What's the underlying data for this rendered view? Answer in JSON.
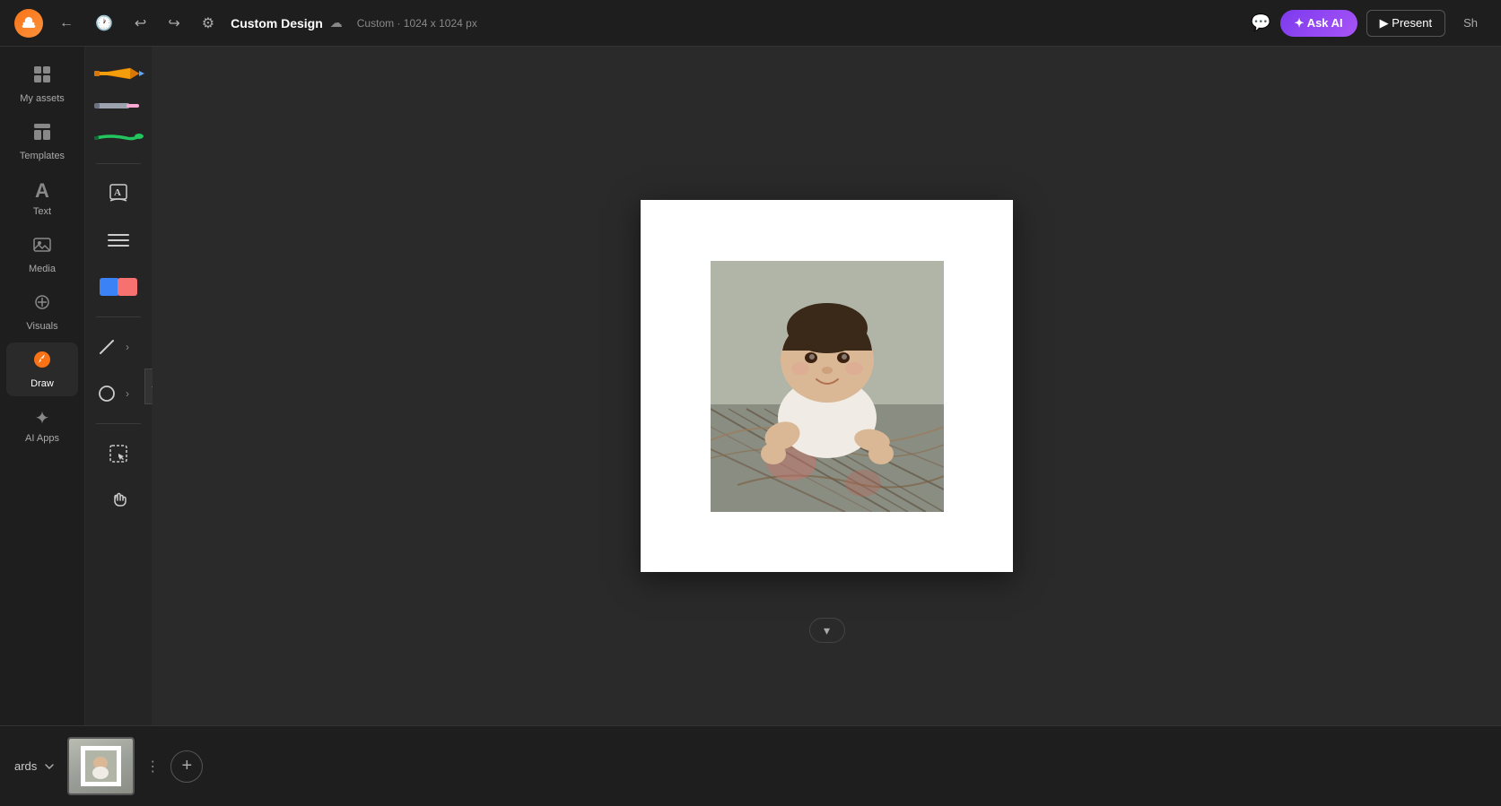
{
  "header": {
    "logo_symbol": "🔥",
    "title": "Custom Design",
    "subtitle": "Custom · 1024 x 1024 px",
    "cloud_icon": "☁",
    "ask_ai_label": "✦ Ask AI",
    "present_label": "▶ Present",
    "share_label": "Sh",
    "comment_icon": "💬"
  },
  "sidebar": {
    "items": [
      {
        "id": "my-assets",
        "label": "My assets",
        "icon": "🗂"
      },
      {
        "id": "templates",
        "label": "Templates",
        "icon": "⊞"
      },
      {
        "id": "text",
        "label": "Text",
        "icon": "A"
      },
      {
        "id": "media",
        "label": "Media",
        "icon": "🖼"
      },
      {
        "id": "visuals",
        "label": "Visuals",
        "icon": "⬇"
      },
      {
        "id": "draw",
        "label": "Draw",
        "icon": "✏",
        "active": true
      },
      {
        "id": "ai-apps",
        "label": "AI Apps",
        "icon": "✦"
      }
    ]
  },
  "tools": {
    "pencil_color": "#f59e0b",
    "marker_color": "#9ca3af",
    "brush_color": "#22c55e",
    "swatch_colors": [
      "#3b82f6",
      "#f87171"
    ],
    "text_tool_icon": "⊞",
    "align_icon": "☰",
    "fill_color": "#3b82f6",
    "line_icon": "/",
    "circle_icon": "○",
    "select_icon": "⊡",
    "hand_icon": "✋",
    "collapse_icon": "‹"
  },
  "canvas": {
    "background": "#ffffff",
    "image_alt": "Baby photo on patterned fabric"
  },
  "bottom_bar": {
    "pages_label": "ards",
    "chevron_label": "▼",
    "add_page_label": "+",
    "page_options_label": "⋮"
  }
}
